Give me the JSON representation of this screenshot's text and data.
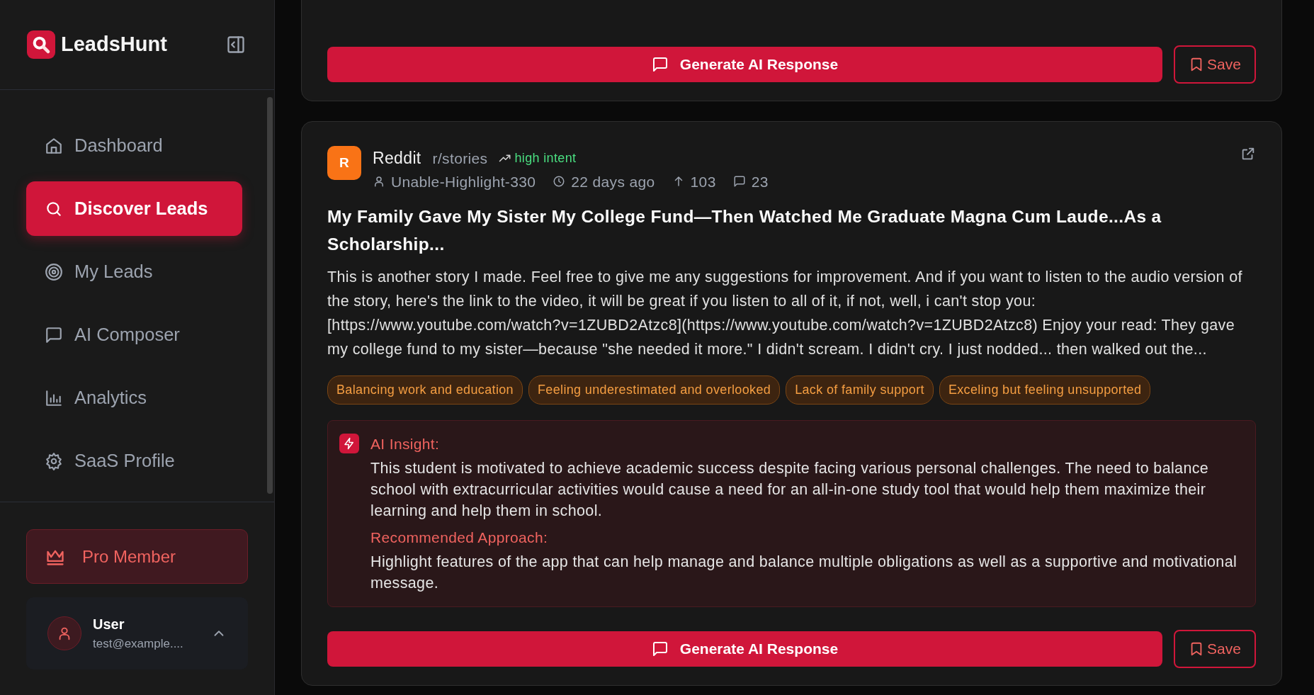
{
  "app": {
    "name": "LeadsHunt"
  },
  "sidebar": {
    "items": [
      {
        "label": "Dashboard",
        "selected": false
      },
      {
        "label": "Discover Leads",
        "selected": true
      },
      {
        "label": "My Leads",
        "selected": false
      },
      {
        "label": "AI Composer",
        "selected": false
      },
      {
        "label": "Analytics",
        "selected": false
      },
      {
        "label": "SaaS Profile",
        "selected": false
      }
    ]
  },
  "plan": {
    "label": "Pro Member"
  },
  "user": {
    "name": "User",
    "email": "test@example...."
  },
  "posts": [
    {
      "kind": "cut",
      "generate_label": "Generate AI Response",
      "save_label": "Save"
    },
    {
      "kind": "full",
      "avatar": "R",
      "platform": "Reddit",
      "community": "r/stories",
      "intent": "high intent",
      "author": "Unable-Highlight-330",
      "age": "22 days ago",
      "upvotes": "103",
      "comments": "23",
      "title": "My Family Gave My Sister My College Fund—Then Watched Me Graduate Magna Cum Laude...As a Scholarship...",
      "body": "This is another story I made. Feel free to give me any suggestions for improvement. And if you want to listen to the audio version of the story, here's the link to the video, it will be great if you listen to all of it, if not, well, i can't stop you: [https://www.youtube.com/watch?v=1ZUBD2Atzc8](https://www.youtube.com/watch?v=1ZUBD2Atzc8) Enjoy your read: They gave my college fund to my sister—because \"she needed it more.\" I didn't scream. I didn't cry. I just nodded... then walked out the...",
      "tags": [
        "Balancing work and education",
        "Feeling underestimated and overlooked",
        "Lack of family support",
        "Exceling but feeling unsupported"
      ],
      "insight_label": "AI Insight:",
      "insight": "This student is motivated to achieve academic success despite facing various personal challenges. The need to balance school with extracurricular activities would cause a need for an all-in-one study tool that would help them maximize their learning and help them in school.",
      "approach_label": "Recommended Approach:",
      "approach": "Highlight features of the app that can help manage and balance multiple obligations as well as a supportive and motivational message.",
      "generate_label": "Generate AI Response",
      "save_label": "Save"
    }
  ]
}
